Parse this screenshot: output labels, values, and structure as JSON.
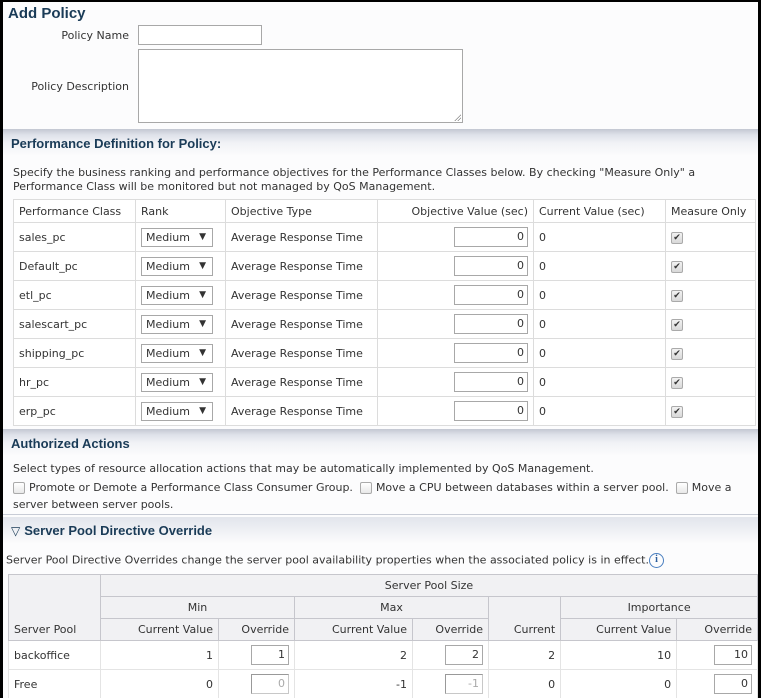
{
  "page": {
    "title": "Add Policy"
  },
  "form": {
    "policy_name_label": "Policy Name",
    "policy_name_value": "",
    "policy_description_label": "Policy Description",
    "policy_description_value": ""
  },
  "performance": {
    "title": "Performance Definition for Policy:",
    "description_line1": "Specify the business ranking and performance objectives for the Performance Classes below. By checking \"Measure Only\" a",
    "description_line2": "Performance Class will be monitored but not managed by QoS Management.",
    "columns": [
      "Performance Class",
      "Rank",
      "Objective Type",
      "Objective Value (sec)",
      "Current Value (sec)",
      "Measure Only"
    ],
    "rows": [
      {
        "name": "sales_pc",
        "rank": "Medium",
        "objective_type": "Average Response Time",
        "objective_value": "0",
        "current_value": "0",
        "measure_only": true
      },
      {
        "name": "Default_pc",
        "rank": "Medium",
        "objective_type": "Average Response Time",
        "objective_value": "0",
        "current_value": "0",
        "measure_only": true
      },
      {
        "name": "etl_pc",
        "rank": "Medium",
        "objective_type": "Average Response Time",
        "objective_value": "0",
        "current_value": "0",
        "measure_only": true
      },
      {
        "name": "salescart_pc",
        "rank": "Medium",
        "objective_type": "Average Response Time",
        "objective_value": "0",
        "current_value": "0",
        "measure_only": true
      },
      {
        "name": "shipping_pc",
        "rank": "Medium",
        "objective_type": "Average Response Time",
        "objective_value": "0",
        "current_value": "0",
        "measure_only": true
      },
      {
        "name": "hr_pc",
        "rank": "Medium",
        "objective_type": "Average Response Time",
        "objective_value": "0",
        "current_value": "0",
        "measure_only": true
      },
      {
        "name": "erp_pc",
        "rank": "Medium",
        "objective_type": "Average Response Time",
        "objective_value": "0",
        "current_value": "0",
        "measure_only": true
      }
    ],
    "dropdown_arrow": "▼",
    "check_glyph": "✔"
  },
  "actions": {
    "title": "Authorized Actions",
    "description": "Select types of resource allocation actions that may be automatically implemented by QoS Management.",
    "options": [
      {
        "label": "Promote or Demote a Performance Class Consumer Group.",
        "checked": false
      },
      {
        "label": "Move a CPU between databases within a server pool.",
        "checked": false
      },
      {
        "label": "Move a",
        "checked": false
      }
    ],
    "wrap_text": "server between server pools."
  },
  "server_pool": {
    "title": "Server Pool Directive Override",
    "toggle_glyph": "▽",
    "description": "Server Pool Directive Overrides change the server pool availability properties when the associated policy is in effect.",
    "info_glyph": "i",
    "headers": {
      "group": "Server Pool Size",
      "min": "Min",
      "max": "Max",
      "importance": "Importance",
      "server_pool": "Server Pool",
      "current_value": "Current Value",
      "override": "Override",
      "current": "Current"
    },
    "rows": [
      {
        "name": "backoffice",
        "min_current": "1",
        "min_override": "1",
        "max_current": "2",
        "max_override": "2",
        "current": "2",
        "importance_current": "10",
        "importance_override": "10",
        "disabled": false
      },
      {
        "name": "Free",
        "min_current": "0",
        "min_override": "0",
        "max_current": "-1",
        "max_override": "-1",
        "current": "0",
        "importance_current": "0",
        "importance_override": "0",
        "disabled": true
      }
    ]
  }
}
